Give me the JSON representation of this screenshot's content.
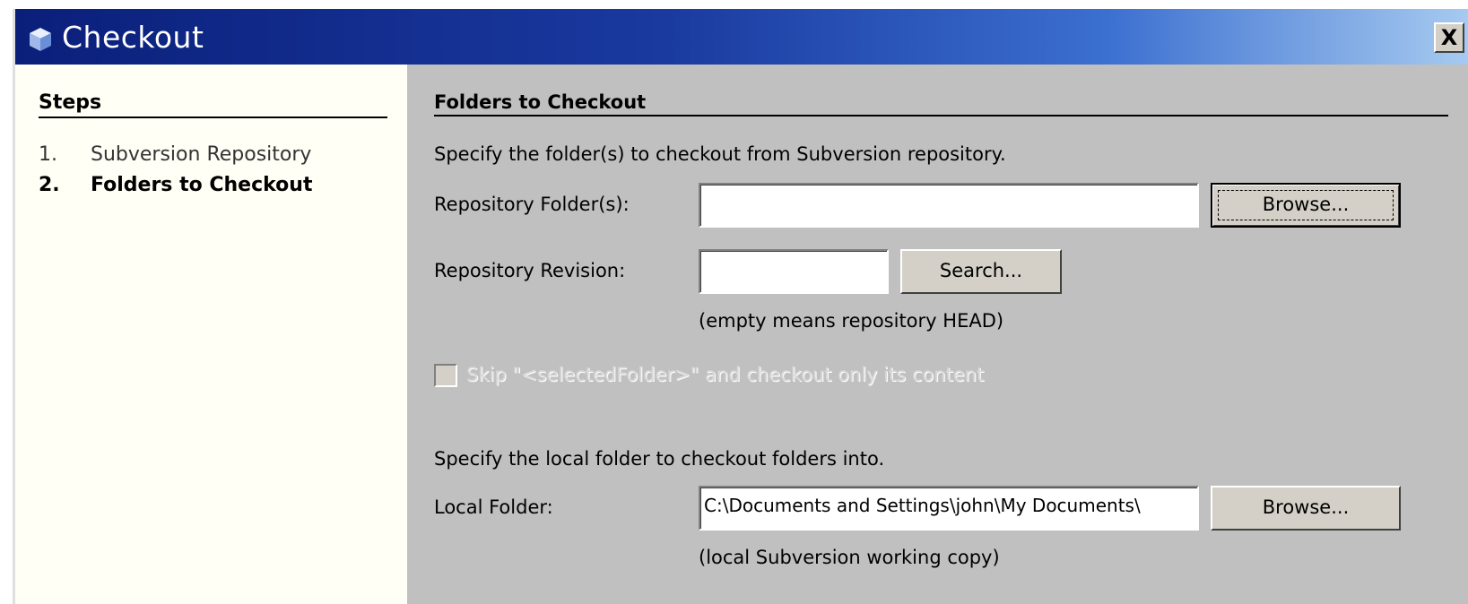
{
  "window": {
    "title": "Checkout",
    "close_label": "X"
  },
  "steps": {
    "heading": "Steps",
    "items": [
      {
        "number": "1.",
        "label": "Subversion Repository"
      },
      {
        "number": "2.",
        "label": "Folders to Checkout"
      }
    ]
  },
  "main": {
    "section_title": "Folders to Checkout",
    "intro": "Specify the folder(s) to checkout from Subversion repository.",
    "repo_folder_label": "Repository Folder(s):",
    "repo_folder_value": "",
    "repo_folder_browse": "Browse...",
    "repo_revision_label": "Repository Revision:",
    "repo_revision_value": "",
    "search_label": "Search...",
    "revision_hint": "(empty means repository HEAD)",
    "skip_checkbox_label": "Skip \"<selectedFolder>\" and checkout only its content",
    "local_intro": "Specify the local folder to checkout folders into.",
    "local_folder_label": "Local Folder:",
    "local_folder_value": "C:\\Documents and Settings\\john\\My Documents\\",
    "local_browse": "Browse...",
    "local_hint": "(local Subversion working copy)"
  }
}
